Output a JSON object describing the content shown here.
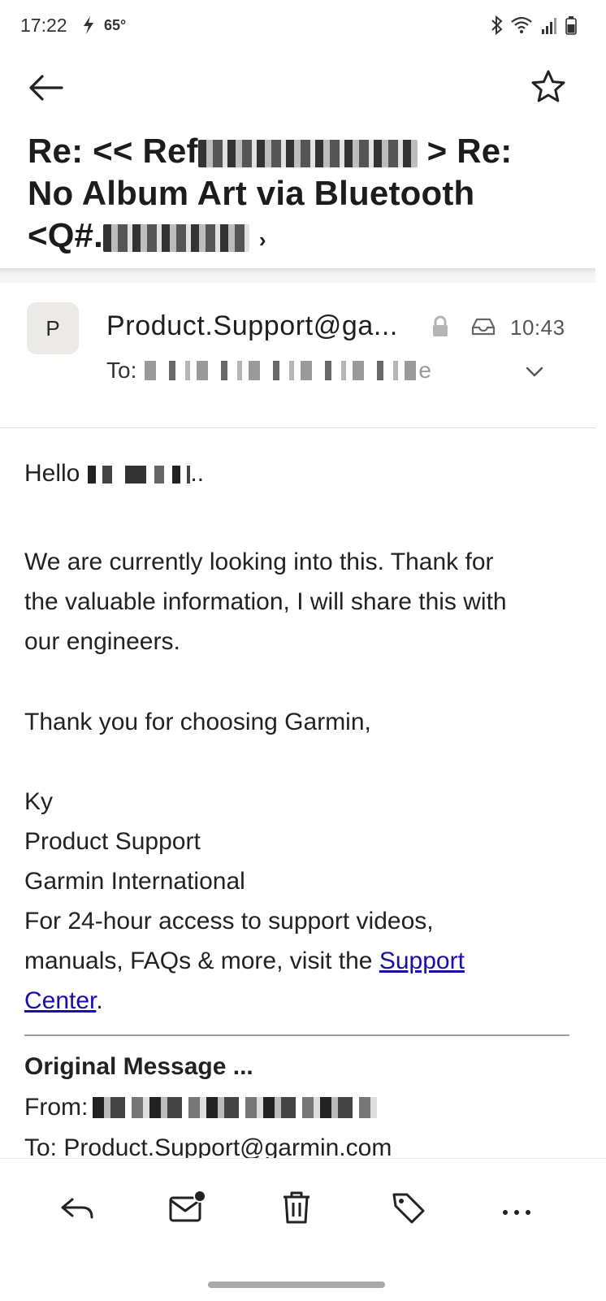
{
  "status_bar": {
    "time": "17:22",
    "temperature": "65°"
  },
  "email": {
    "subject_line1_prefix": "Re: << Ref",
    "subject_line1_suffix": "> Re:",
    "subject_line2": "No Album Art via Bluetooth",
    "subject_line3_prefix": "<Q#.",
    "subject_line3_suffix": "›"
  },
  "sender": {
    "avatar_initial": "P",
    "name": "Product.Support@ga...",
    "time": "10:43",
    "to_label": "To:",
    "to_suffix": "e"
  },
  "body": {
    "greeting": "Hello",
    "greeting_end": "..",
    "para1_line1": "We are currently looking into this. Thank for",
    "para1_line2": "the valuable information, I will share this with",
    "para1_line3": "our engineers.",
    "thanks": "Thank you for choosing Garmin,",
    "sig_name": "Ky",
    "sig_dept": "Product Support",
    "sig_company": "Garmin International",
    "sig_line4": "For 24-hour access to support videos,",
    "sig_line5_prefix": "manuals, FAQs & more, visit the ",
    "link_part1": "Support",
    "link_part2": "Center",
    "sig_line6_suffix": "."
  },
  "original": {
    "title": "Original Message ...",
    "from_label": "From:",
    "to_line": "To: Product.Support@garmin.com"
  },
  "icons": {
    "back": "arrow-left-icon",
    "star": "star-icon",
    "lock": "lock-icon",
    "inbox": "inbox-icon",
    "expand": "chevron-down-icon",
    "reply": "reply-icon",
    "mark_unread": "mail-unread-icon",
    "delete": "trash-icon",
    "label": "tag-icon",
    "more": "more-horizontal-icon"
  },
  "colors": {
    "link": "#1a0dab",
    "avatar_bg": "#eceae7"
  }
}
